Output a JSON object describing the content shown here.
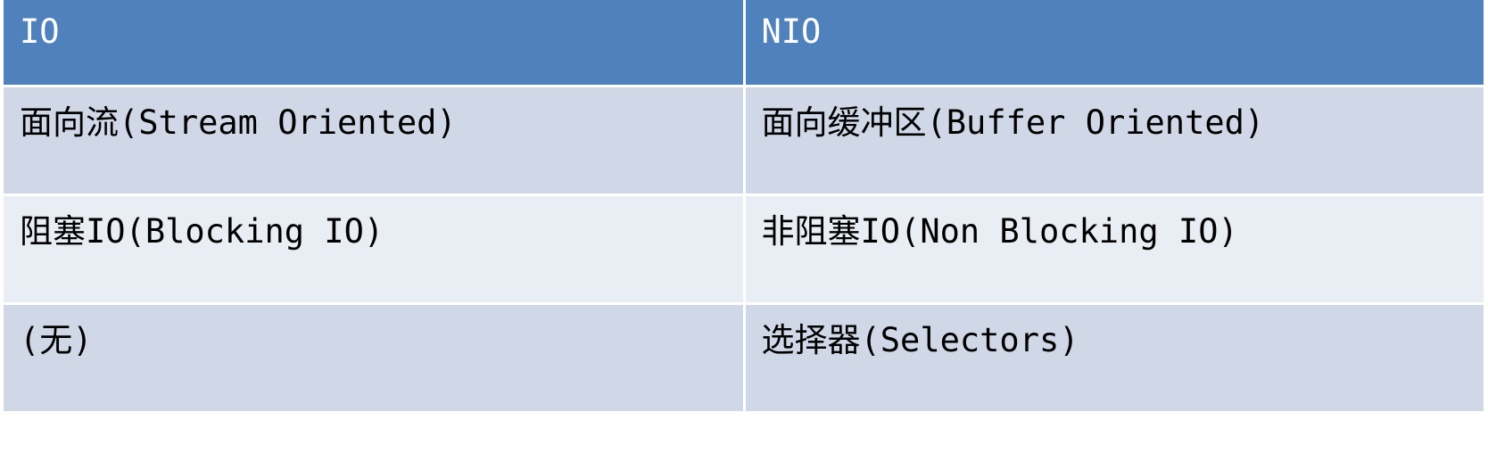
{
  "table": {
    "headers": [
      "IO",
      "NIO"
    ],
    "rows": [
      [
        "面向流(Stream Oriented)",
        "面向缓冲区(Buffer Oriented)"
      ],
      [
        "阻塞IO(Blocking IO)",
        "非阻塞IO(Non Blocking IO)"
      ],
      [
        "(无)",
        "选择器(Selectors)"
      ]
    ]
  },
  "colors": {
    "header_bg": "#4f81bd",
    "row_odd_bg": "#d0d8e8",
    "row_even_bg": "#e9edf4",
    "header_text": "#ffffff",
    "body_text": "#000000"
  }
}
